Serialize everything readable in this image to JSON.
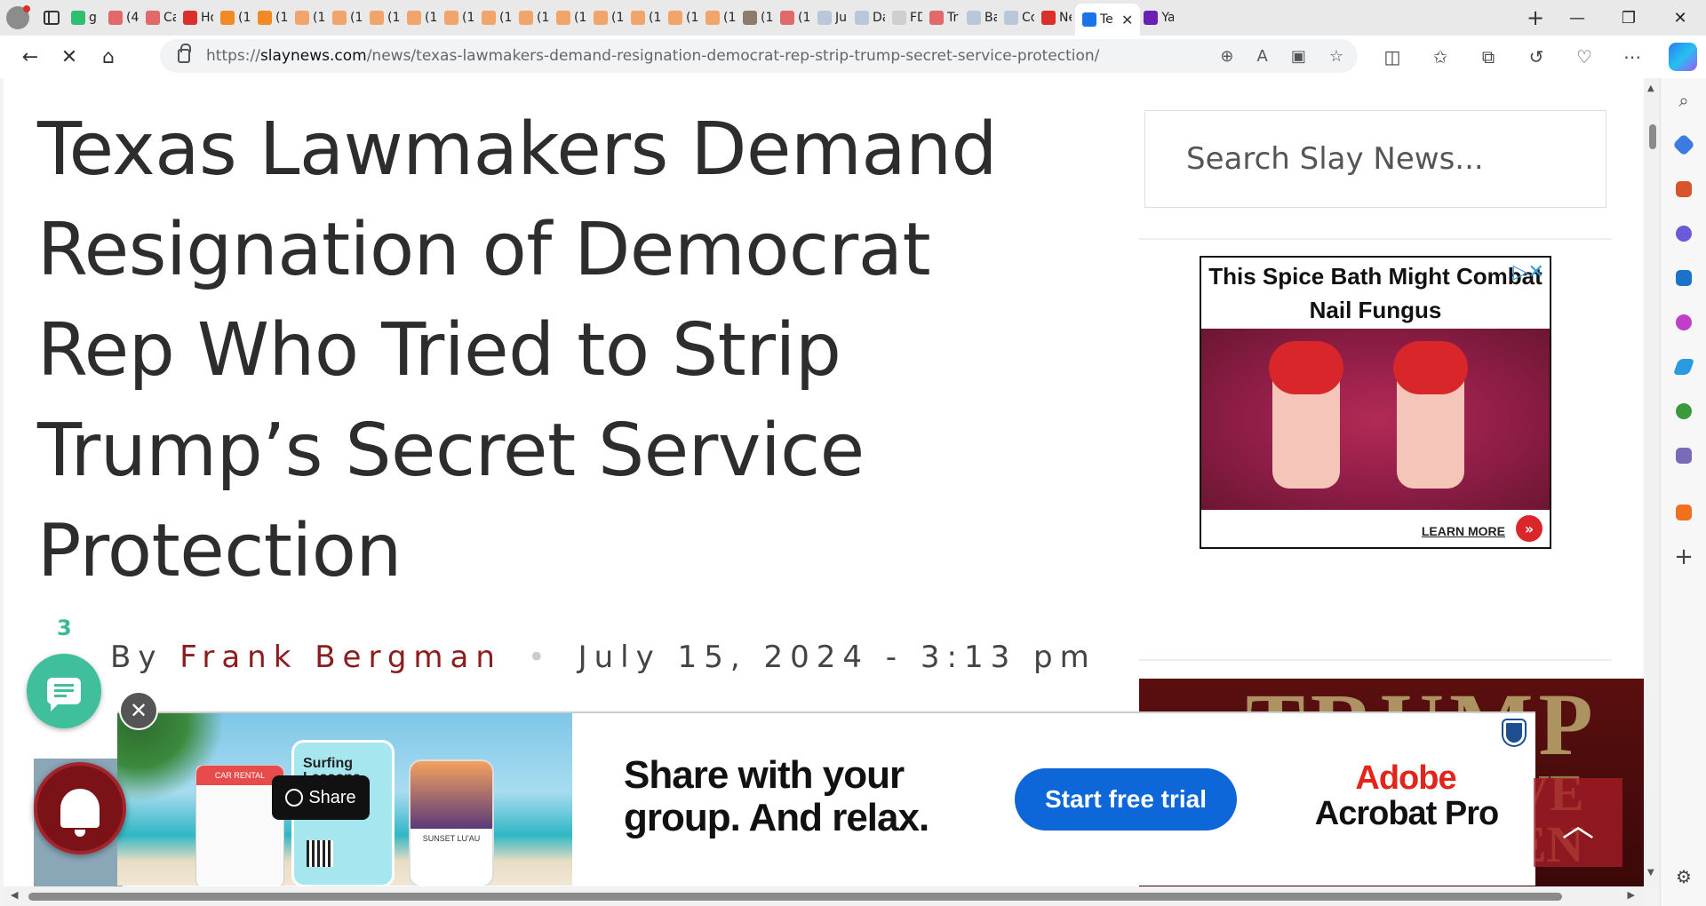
{
  "browser": {
    "tabs": [
      {
        "label": "g",
        "color": "#2fbf71"
      },
      {
        "label": "(4:",
        "color": "#e06a6a"
      },
      {
        "label": "Ca",
        "color": "#e06a6a"
      },
      {
        "label": "Ho",
        "color": "#d9302b"
      },
      {
        "label": "(1(",
        "color": "#f08a24"
      },
      {
        "label": "(1(",
        "color": "#f08a24"
      },
      {
        "label": "(1(",
        "color": "#f2a56b"
      },
      {
        "label": "(1(",
        "color": "#f2a56b"
      },
      {
        "label": "(1(",
        "color": "#f2a56b"
      },
      {
        "label": "(1(",
        "color": "#f2a56b"
      },
      {
        "label": "(1(",
        "color": "#f2a56b"
      },
      {
        "label": "(1(",
        "color": "#f2a56b"
      },
      {
        "label": "(1(",
        "color": "#f2a56b"
      },
      {
        "label": "(1(",
        "color": "#f2a56b"
      },
      {
        "label": "(1(",
        "color": "#f2a56b"
      },
      {
        "label": "(1(",
        "color": "#f2a56b"
      },
      {
        "label": "(1(",
        "color": "#f2a56b"
      },
      {
        "label": "(1(",
        "color": "#f2a56b"
      },
      {
        "label": "(1(",
        "color": "#8c7a6b"
      },
      {
        "label": "(1(",
        "color": "#e06a6a"
      },
      {
        "label": "Ju",
        "color": "#b8c7d9"
      },
      {
        "label": "Da",
        "color": "#b8c7d9"
      },
      {
        "label": "FD",
        "color": "#cfcfcf"
      },
      {
        "label": "Tr",
        "color": "#e06a6a"
      },
      {
        "label": "Ba",
        "color": "#b8c7d9"
      },
      {
        "label": "Co",
        "color": "#b8c7d9"
      },
      {
        "label": "Ne",
        "color": "#d9302b"
      }
    ],
    "active_tab": {
      "label": "Te",
      "color": "#1a73e8"
    },
    "after_tab": {
      "label": "Ya",
      "color": "#6a1fb5"
    },
    "url_domain": "slaynews.com",
    "url_prefix": "https://",
    "url_path": "/news/texas-lawmakers-demand-resignation-democrat-rep-strip-trump-secret-service-protection/"
  },
  "article": {
    "headline": "Texas Lawmakers Demand Resignation of Democrat Rep Who Tried to Strip Trump’s Secret Service Protection",
    "byline_prefix": "By",
    "author": "Frank Bergman",
    "separator": "•",
    "date": "July 15, 2024 - 3:13 pm",
    "comment_count": "3"
  },
  "sidebar": {
    "search_placeholder": "Search Slay News...",
    "ad": {
      "headline": "This Spice Bath Might Combat Nail Fungus",
      "cta": "LEARN MORE"
    },
    "image_text_main": "TRUMP",
    "image_text_side": "VE EN"
  },
  "banner": {
    "share_label": "Share",
    "card1_title": "CAR RENTAL",
    "card2_title": "Surfing Lessons",
    "card3_title": "SUNSET LU'AU",
    "message": "Share with your group. And relax.",
    "cta": "Start free trial",
    "brand_line1": "Adobe",
    "brand_line2": "Acrobat Pro"
  },
  "colors": {
    "accent_author": "#8a1e1e",
    "comment_green": "#3fbf9c",
    "cta_blue": "#0d67d8",
    "adobe_red": "#e1251b"
  }
}
